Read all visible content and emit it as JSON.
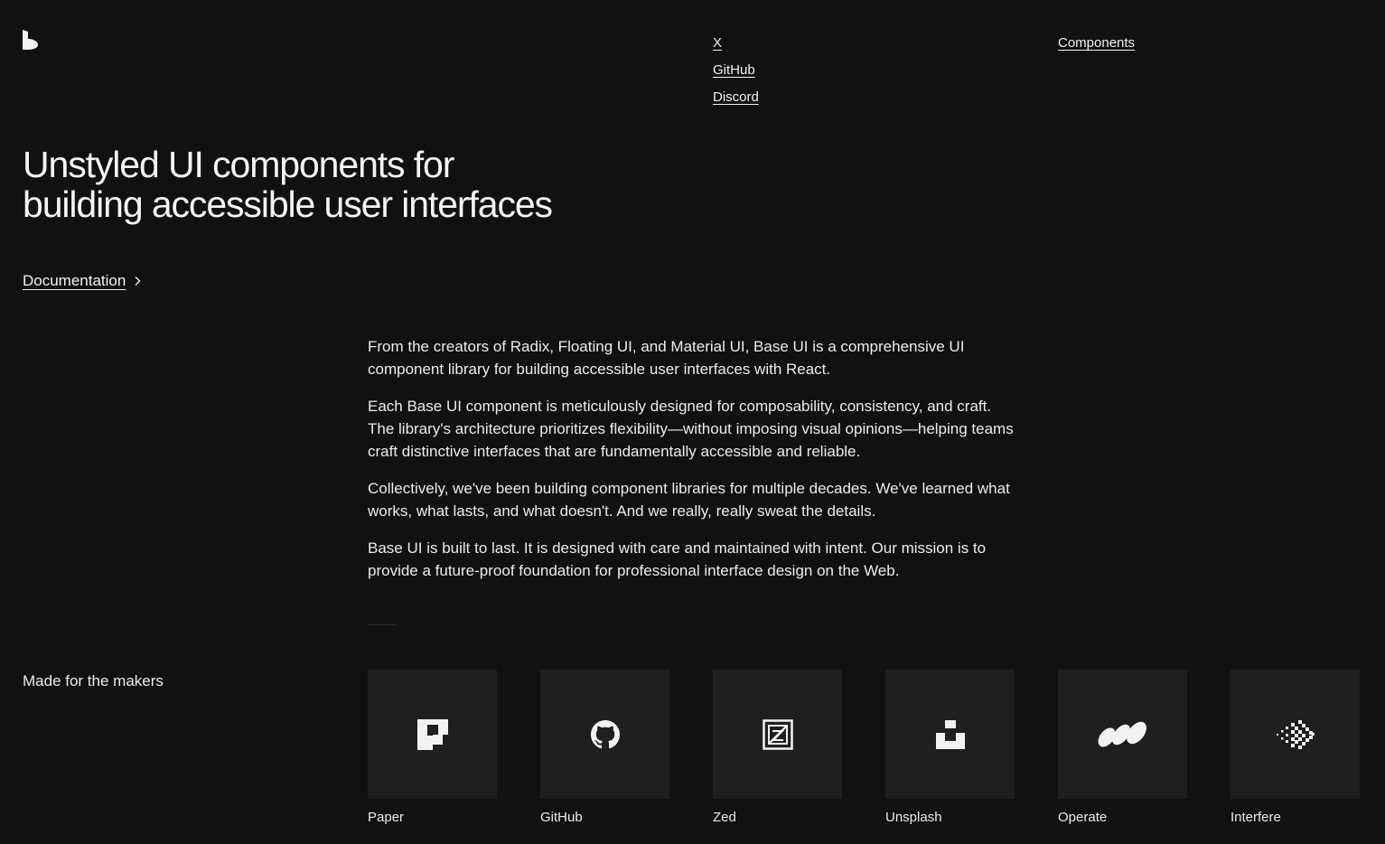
{
  "nav": {
    "social": [
      {
        "label": "X"
      },
      {
        "label": "GitHub"
      },
      {
        "label": "Discord"
      }
    ],
    "components_label": "Components"
  },
  "hero": {
    "title_line1": "Unstyled UI components for",
    "title_line2": "building accessible user interfaces",
    "doc_link_label": "Documentation"
  },
  "intro": {
    "paragraphs": [
      "From the creators of Radix, Floating UI, and Material UI, Base UI is a comprehensive UI component library for building accessible user interfaces with React.",
      "Each Base UI component is meticulously designed for composability, consistency, and craft. The library's architecture prioritizes flexibility—without imposing visual opinions—helping teams craft distinctive interfaces that are fundamentally accessible and reliable.",
      "Collectively, we've been building component libraries for multiple decades. We've learned what works, what lasts, and what doesn't. And we really, really sweat the details.",
      "Base UI is built to last. It is designed with care and maintained with intent. Our mission is to provide a future-proof foundation for professional interface design on the Web."
    ]
  },
  "makers": {
    "heading": "Made for the makers",
    "items": [
      {
        "name": "Paper",
        "icon": "paper-logo-icon"
      },
      {
        "name": "GitHub",
        "icon": "github-logo-icon"
      },
      {
        "name": "Zed",
        "icon": "zed-logo-icon"
      },
      {
        "name": "Unsplash",
        "icon": "unsplash-logo-icon"
      },
      {
        "name": "Operate",
        "icon": "operate-logo-icon"
      },
      {
        "name": "Interfere",
        "icon": "interfere-logo-icon"
      }
    ]
  },
  "colors": {
    "background": "#111111",
    "text": "#f2f2f2",
    "tile": "#1f1f1f"
  }
}
